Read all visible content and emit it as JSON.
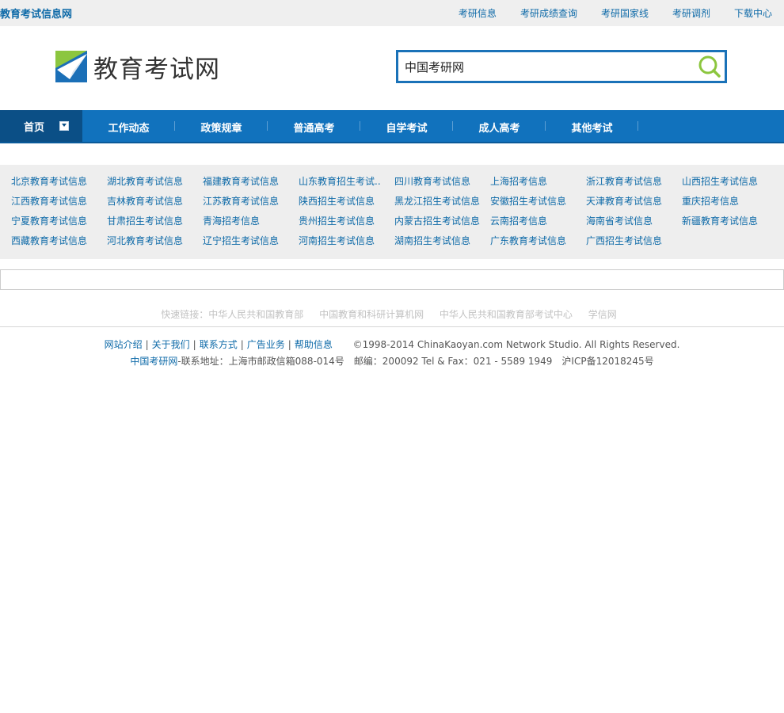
{
  "topbar": {
    "site_name": "教育考试信息网",
    "links": [
      "考研信息",
      "考研成绩查询",
      "考研国家线",
      "考研调剂",
      "下载中心"
    ]
  },
  "header": {
    "logo_text": "教育考试网",
    "search_value": "中国考研网"
  },
  "nav": {
    "home": "首页",
    "items": [
      "工作动态",
      "政策规章",
      "普通高考",
      "自学考试",
      "成人高考",
      "其他考试"
    ]
  },
  "provinces": [
    "北京教育考试信息",
    "湖北教育考试信息",
    "福建教育考试信息",
    "山东教育招生考试..",
    "四川教育考试信息",
    "上海招考信息",
    "浙江教育考试信息",
    "山西招生考试信息",
    "江西教育考试信息",
    "吉林教育考试信息",
    "江苏教育考试信息",
    "陕西招生考试信息",
    "黑龙江招生考试信息",
    "安徽招生考试信息",
    "天津教育考试信息",
    "重庆招考信息",
    "宁夏教育考试信息",
    "甘肃招生考试信息",
    "青海招考信息",
    "贵州招生考试信息",
    "内蒙古招生考试信息",
    "云南招考信息",
    "海南省考试信息",
    "新疆教育考试信息",
    "西藏教育考试信息",
    "河北教育考试信息",
    "辽宁招生考试信息",
    "河南招生考试信息",
    "湖南招生考试信息",
    "广东教育考试信息",
    "广西招生考试信息"
  ],
  "quick_links": {
    "label": "快速链接：",
    "items": [
      "中华人民共和国教育部",
      "中国教育和科研计算机网",
      "中华人民共和国教育部考试中心",
      "学信网"
    ]
  },
  "footer": {
    "links": [
      "网站介绍",
      "关于我们",
      "联系方式",
      "广告业务",
      "帮助信息"
    ],
    "separator": "|",
    "copyright": "©1998-2014 ChinaKaoyan.com Network Studio. All Rights Reserved.",
    "brand": "中国考研网",
    "address": "-联系地址：上海市邮政信箱088-014号　邮编：200092 Tel & Fax：021 - 5589 1949　沪ICP备12018245号"
  },
  "colors": {
    "accent": "#1172bd",
    "link": "#0e6aa8",
    "nav_home_bg": "#0b4f86"
  }
}
